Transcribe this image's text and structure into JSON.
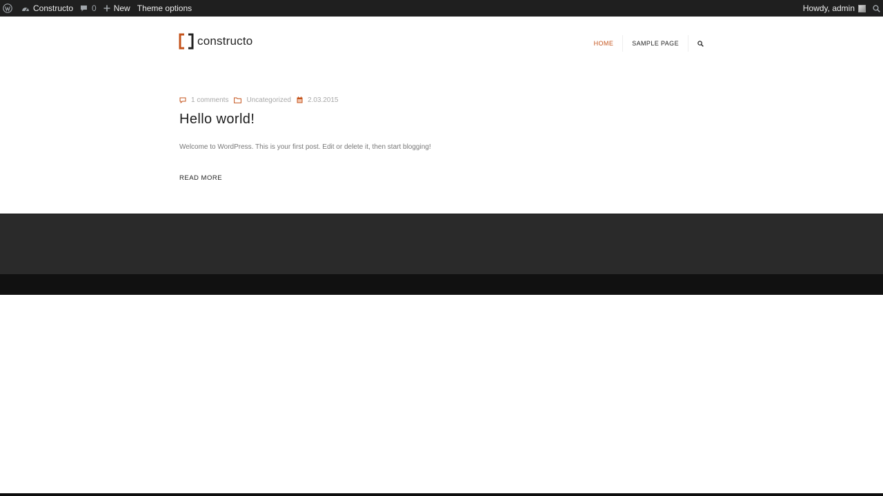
{
  "admin_bar": {
    "wp_logo_icon": "wordpress-logo-icon",
    "site_name": "Constructo",
    "site_icon": "dashboard-icon",
    "comments_count": "0",
    "comments_icon": "comment-bubble-icon",
    "new_label": "New",
    "new_icon": "plus-icon",
    "theme_options_label": "Theme options",
    "howdy_label": "Howdy, admin",
    "search_icon": "search-icon"
  },
  "header": {
    "logo_text": "constructo",
    "nav": [
      {
        "label": "HOME",
        "active": true
      },
      {
        "label": "SAMPLE PAGE",
        "active": false
      }
    ]
  },
  "post": {
    "comments": "1 comments",
    "category": "Uncategorized",
    "date": "2.03.2015",
    "title": "Hello world!",
    "excerpt": "Welcome to WordPress. This is your first post. Edit or delete it, then start blogging!",
    "read_more": "READ MORE"
  },
  "colors": {
    "accent": "#c4531b",
    "admin_bar_bg": "#1f1f1f",
    "footer_bg": "#2a2a2a",
    "footer_bottom_bg": "#111111"
  }
}
